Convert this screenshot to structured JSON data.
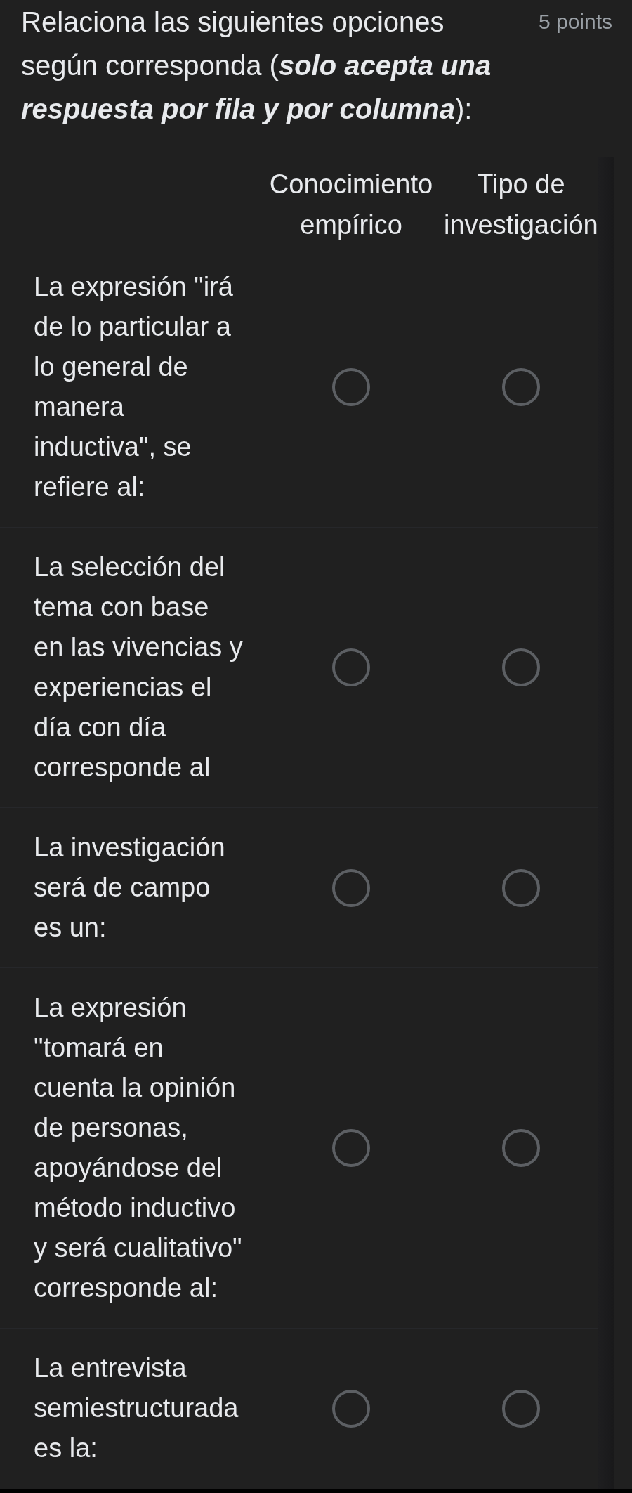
{
  "question": {
    "title": [
      {
        "kind": "plain",
        "text": "Relaciona las siguientes opciones según corresponda ("
      },
      {
        "kind": "bold-italic",
        "text": "solo acepta una respuesta por fila y por columna"
      },
      {
        "kind": "plain",
        "text": "):"
      }
    ],
    "points": "5 points"
  },
  "grid": {
    "columns": [
      "Conocimiento empírico",
      "Tipo de investigación"
    ],
    "rows": [
      {
        "label": "La expresión \"irá de lo particular a lo general de manera inductiva\", se refiere al:",
        "options": [
          {
            "selected": false
          },
          {
            "selected": false
          }
        ]
      },
      {
        "label": "La selección del tema con base en las vivencias y experiencias el día con día corresponde al",
        "options": [
          {
            "selected": false
          },
          {
            "selected": false
          }
        ]
      },
      {
        "label": "La investigación será de campo es un:",
        "options": [
          {
            "selected": false
          },
          {
            "selected": false
          }
        ]
      },
      {
        "label": "La expresión \"tomará en cuenta la opinión de personas, apoyándose del método inductivo y será cualitativo\" corresponde al:",
        "options": [
          {
            "selected": false
          },
          {
            "selected": false
          }
        ]
      },
      {
        "label": "La entrevista semiestructurada es la:",
        "options": [
          {
            "selected": false
          },
          {
            "selected": false
          }
        ]
      }
    ]
  }
}
